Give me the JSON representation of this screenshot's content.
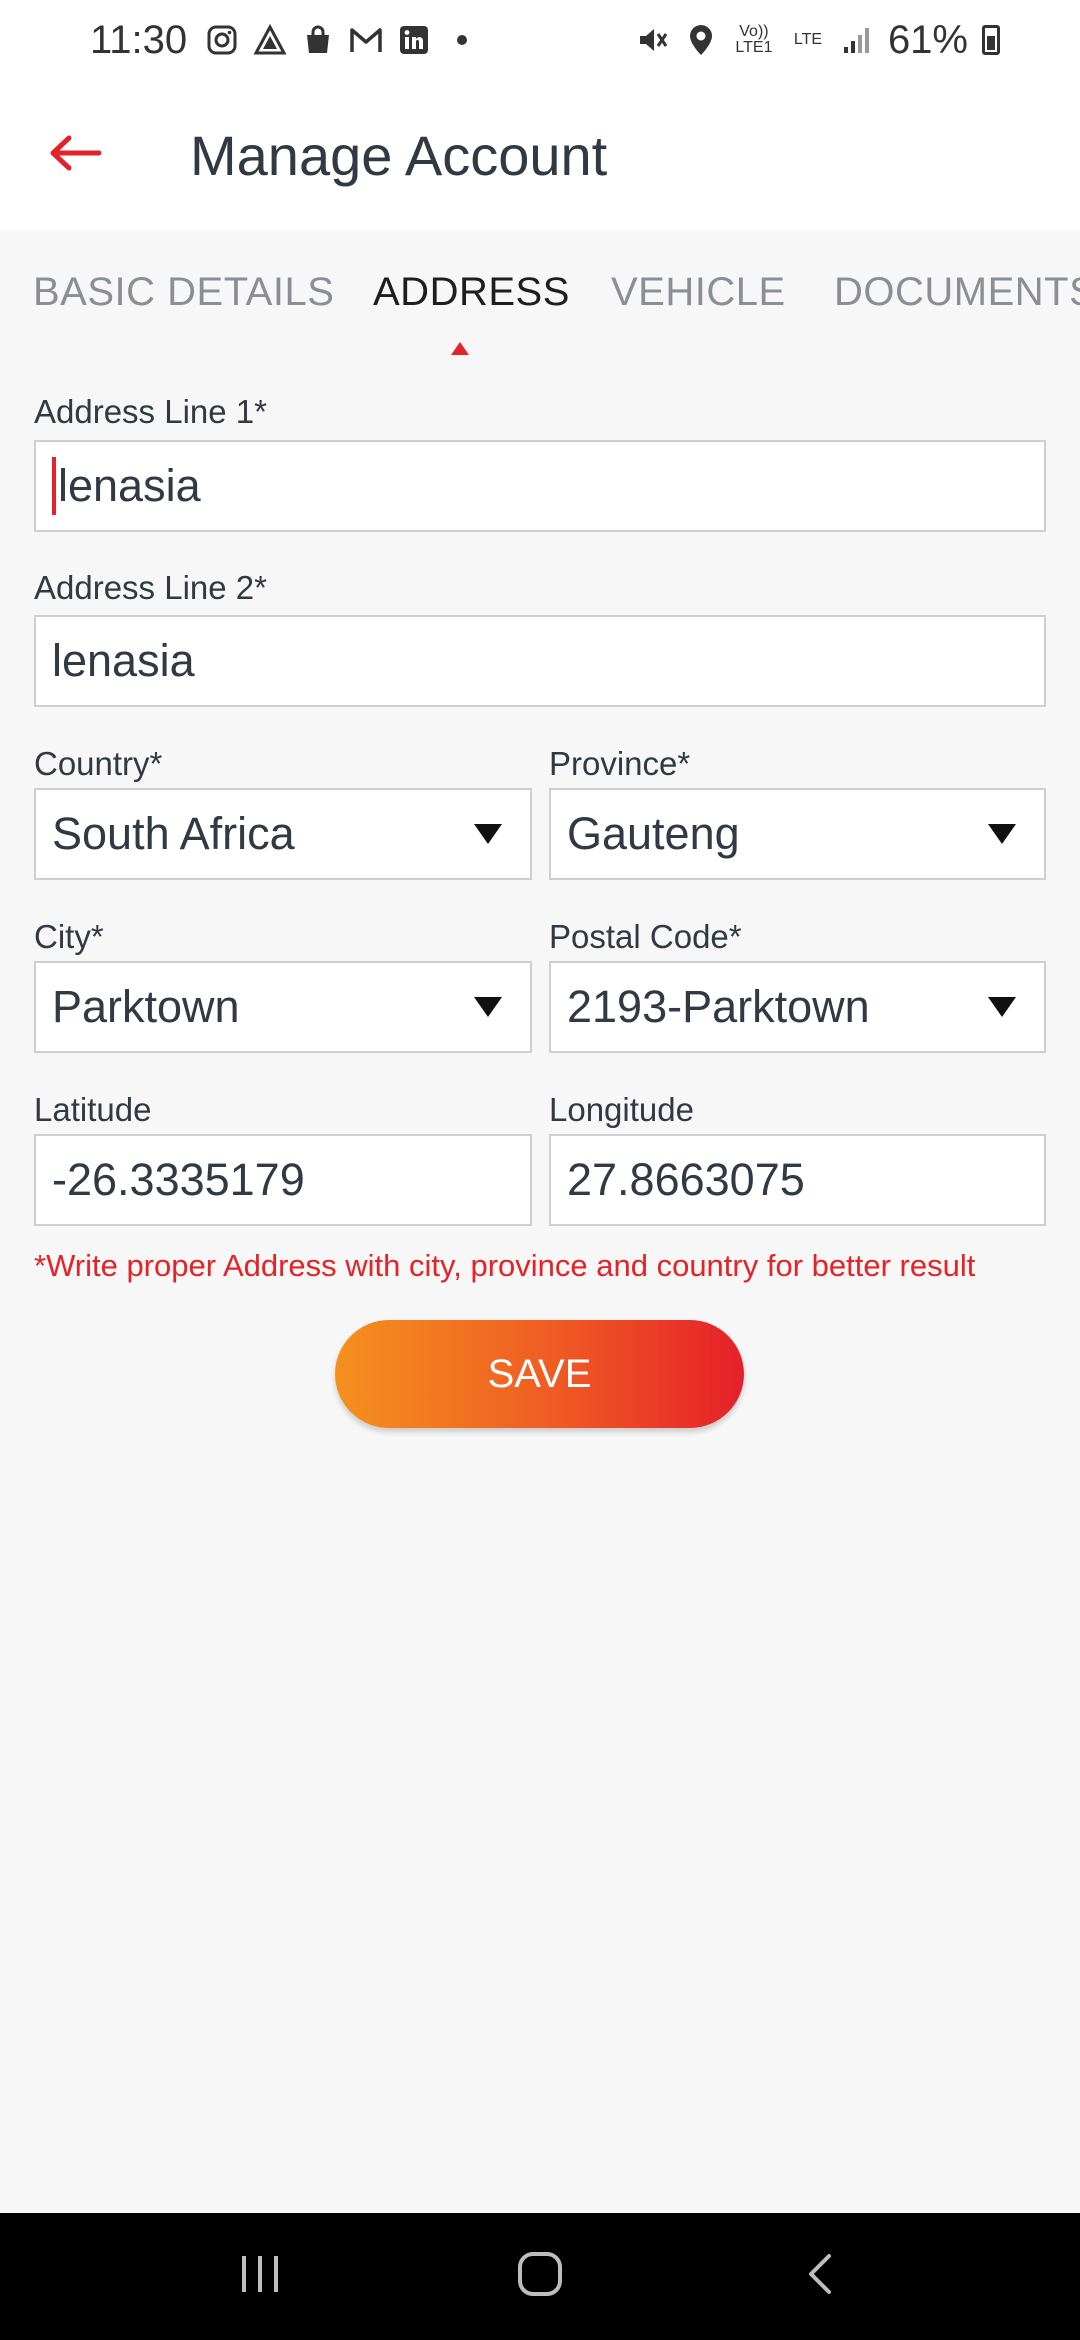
{
  "status_bar": {
    "time": "11:30",
    "left_icons": [
      "instagram-icon",
      "app-icon",
      "shopping-bag-icon",
      "gmail-icon",
      "linkedin-icon",
      "dot-icon"
    ],
    "right_icons": [
      "mute-icon",
      "location-icon",
      "volte-icon",
      "lte-icon",
      "signal-icon"
    ],
    "volte_label": "Vo)) LTE1",
    "lte_label": "LTE",
    "battery_percent": "61%"
  },
  "header": {
    "back_icon": "arrow-left-icon",
    "title": "Manage Account",
    "accent_color": "#e42328"
  },
  "tabs": [
    {
      "label": "BASIC DETAILS",
      "active": false
    },
    {
      "label": "ADDRESS",
      "active": true
    },
    {
      "label": "VEHICLE",
      "active": false
    },
    {
      "label": "DOCUMENTS",
      "active": false
    }
  ],
  "form": {
    "address_line1": {
      "label": "Address Line 1*",
      "value": "lenasia"
    },
    "address_line2": {
      "label": "Address Line 2*",
      "value": "lenasia"
    },
    "country": {
      "label": "Country*",
      "value": "South Africa"
    },
    "province": {
      "label": "Province*",
      "value": "Gauteng"
    },
    "city": {
      "label": "City*",
      "value": "Parktown"
    },
    "postal_code": {
      "label": "Postal Code*",
      "value": "2193-Parktown"
    },
    "latitude": {
      "label": "Latitude",
      "value": "-26.3335179"
    },
    "longitude": {
      "label": "Longitude",
      "value": "27.8663075"
    },
    "hint": "*Write proper Address with city, province and country for better result",
    "save_label": "SAVE"
  },
  "colors": {
    "gradient_start": "#f4901e",
    "gradient_end": "#e5202a",
    "hint_color": "#e42328"
  },
  "nav_bar": {
    "icons": [
      "recent-apps-icon",
      "home-icon",
      "back-icon"
    ]
  }
}
